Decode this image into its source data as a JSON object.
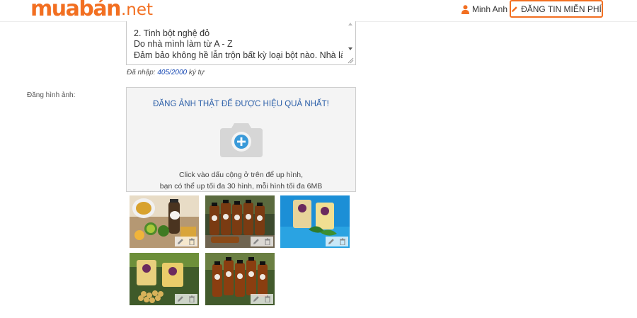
{
  "header": {
    "logo_main": "muabán",
    "logo_tld": ".net",
    "user_name": "Minh Anh",
    "post_button": "ĐĂNG TIN MIỄN PHÍ",
    "brand_color": "#f26f21"
  },
  "description": {
    "visible_lines": [
      "2. Tinh bột nghệ đỏ",
      "Do nhà mình làm từ A - Z",
      "Đảm bảo không hề lẫn trộn bất kỳ loại bột nào. Nhà làm,"
    ],
    "counter_prefix": "Đã nhập:",
    "counter_value": "405/2000",
    "counter_suffix": "ký tự"
  },
  "images": {
    "label": "Đăng hình ảnh:",
    "upload_title": "ĐĂNG ẢNH THẬT ĐỂ ĐƯỢC HIỆU QUẢ NHẤT!",
    "upload_hint_line1": "Click vào dấu cộng ở trên để up hình,",
    "upload_hint_line2": "bạn có thể up tối đa 30 hình, mỗi hình tối đa 6MB",
    "thumbnails_count": 5,
    "thumb_actions": [
      "pencil-icon",
      "trash-icon"
    ]
  }
}
